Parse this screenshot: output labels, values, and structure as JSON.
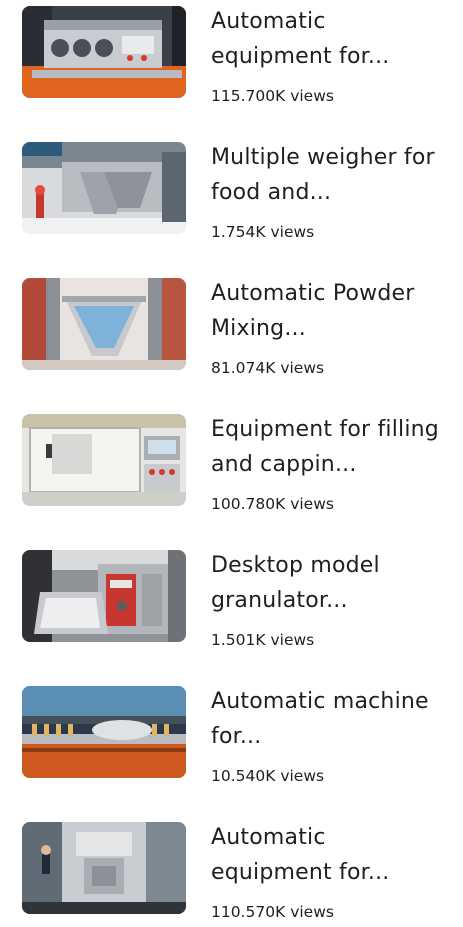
{
  "videos": [
    {
      "title": "Automatic equipment for...",
      "views": "115.700K views",
      "thumbnail": "packaging-machine-photo"
    },
    {
      "title": "Multiple weigher for food and...",
      "views": "1.754K views",
      "thumbnail": "multihead-weigher-photo"
    },
    {
      "title": "Automatic Powder Mixing...",
      "views": "81.074K views",
      "thumbnail": "powder-mixer-photo"
    },
    {
      "title": "Equipment for filling and cappin...",
      "views": "100.780K views",
      "thumbnail": "filling-capping-line-photo"
    },
    {
      "title": "Desktop model granulator...",
      "views": "1.501K views",
      "thumbnail": "desktop-granulator-photo"
    },
    {
      "title": "Automatic machine for...",
      "views": "10.540K views",
      "thumbnail": "bottling-conveyor-photo"
    },
    {
      "title": "Automatic equipment for...",
      "views": "110.570K views",
      "thumbnail": "factory-machine-photo"
    }
  ]
}
